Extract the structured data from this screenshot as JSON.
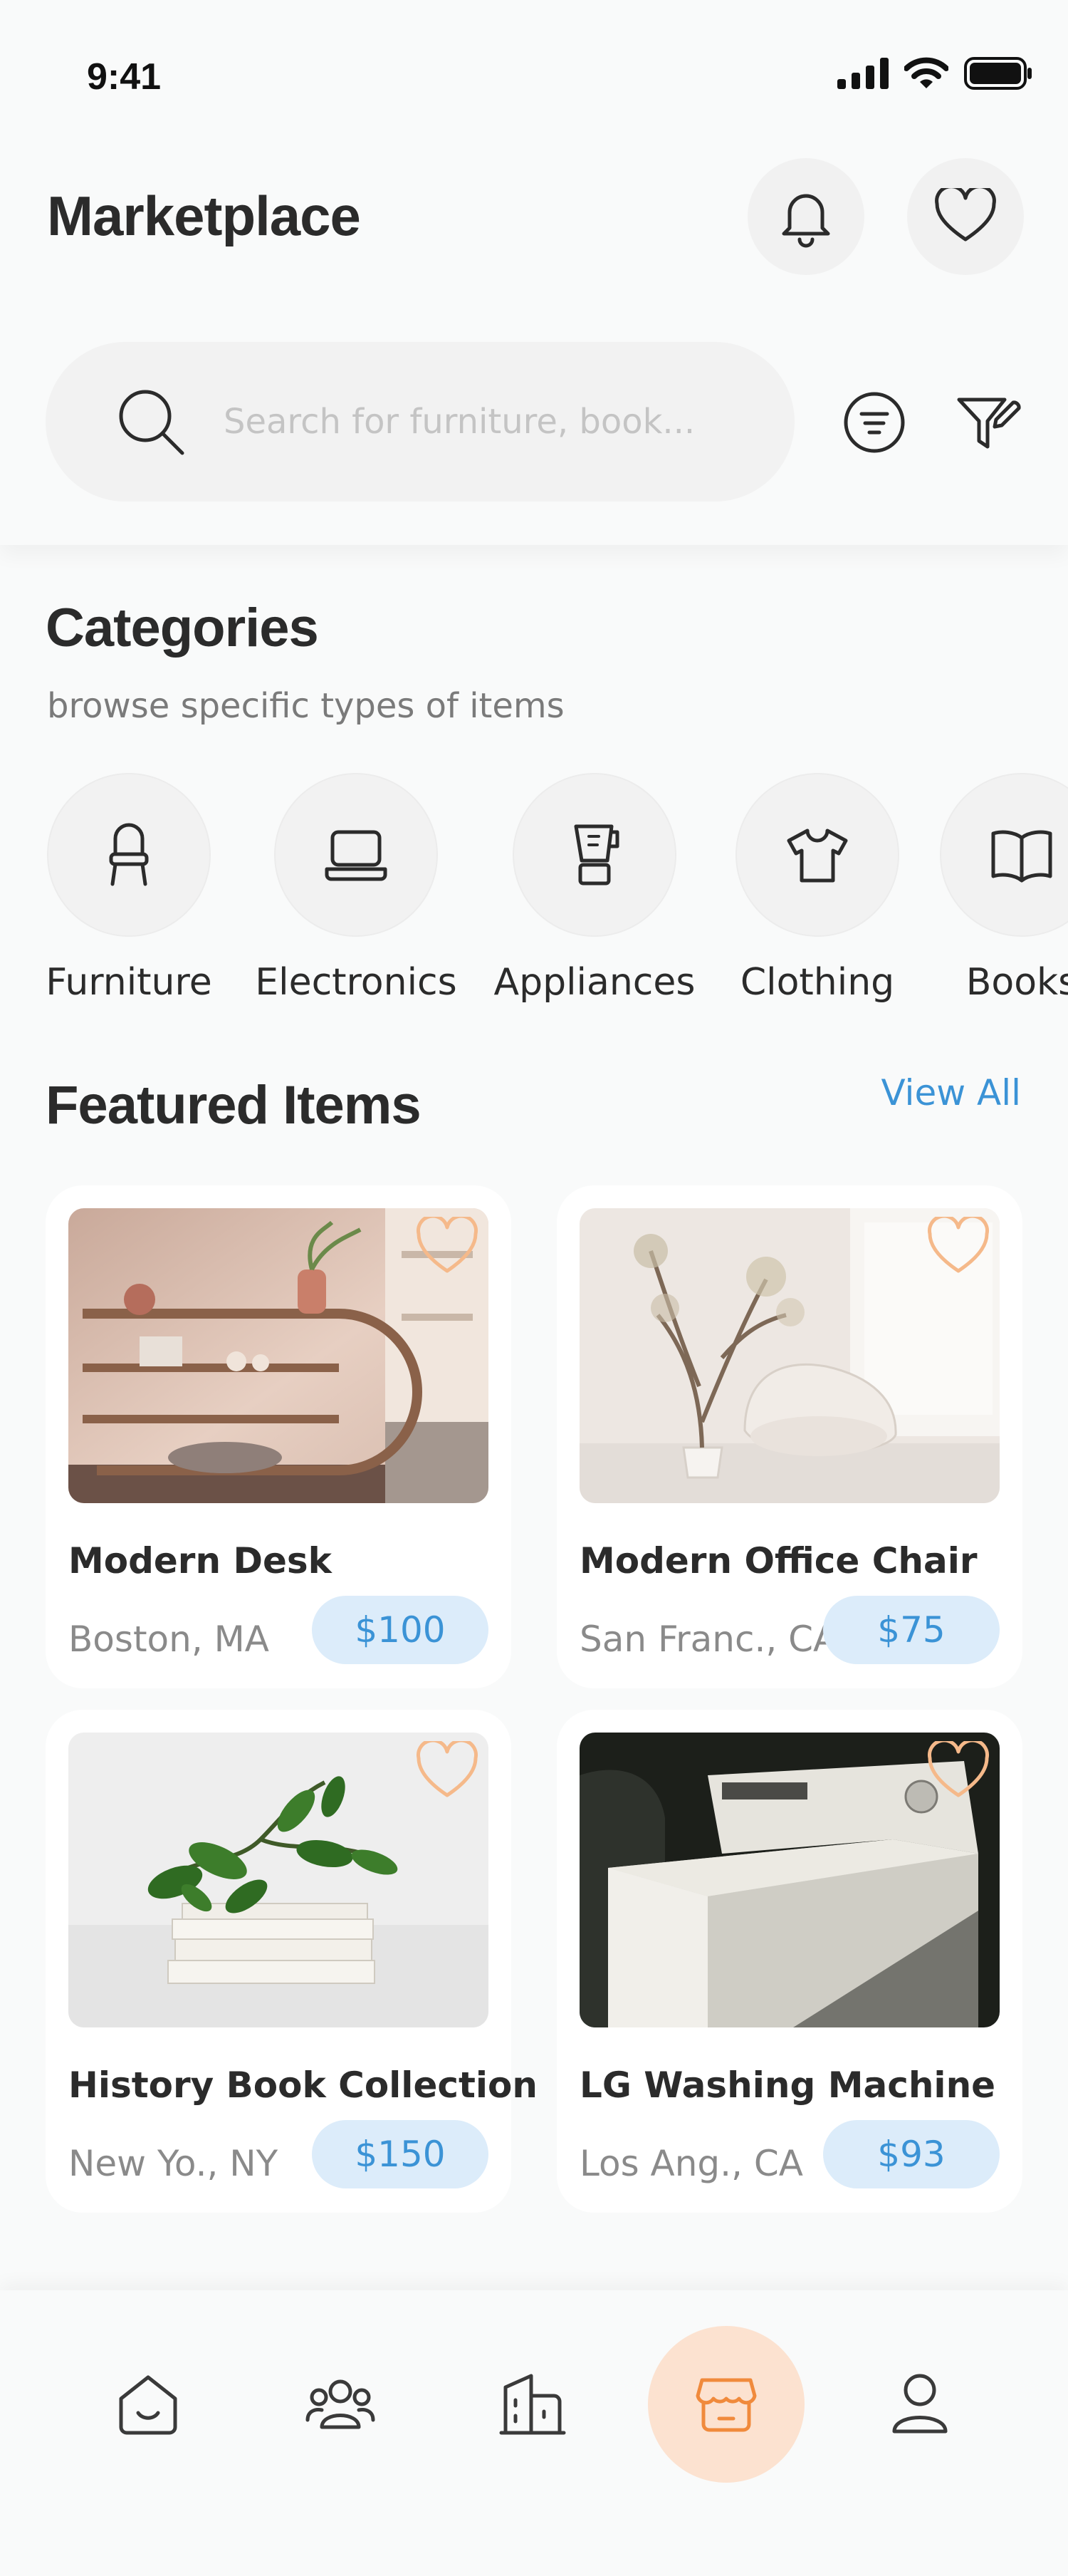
{
  "status": {
    "time": "9:41"
  },
  "header": {
    "title": "Marketplace",
    "search_placeholder": "Search for furniture, book..."
  },
  "categories": {
    "title": "Categories",
    "subtitle": "browse specific types of items",
    "items": [
      {
        "label": "Furniture",
        "icon": "chair-icon"
      },
      {
        "label": "Electronics",
        "icon": "laptop-icon"
      },
      {
        "label": "Appliances",
        "icon": "blender-icon"
      },
      {
        "label": "Clothing",
        "icon": "tshirt-icon"
      },
      {
        "label": "Books",
        "icon": "book-icon"
      }
    ]
  },
  "featured": {
    "title": "Featured Items",
    "view_all": "View All",
    "items": [
      {
        "name": "Modern Desk",
        "location": "Boston, MA",
        "price": "$100"
      },
      {
        "name": "Modern Office Chair",
        "location": "San Franc., CA",
        "price": "$75"
      },
      {
        "name": "History Book Collection",
        "location": "New Yo., NY",
        "price": "$150"
      },
      {
        "name": "LG Washing Machine",
        "location": "Los Ang., CA",
        "price": "$93"
      }
    ]
  },
  "bottom_nav": {
    "items": [
      {
        "icon": "home-icon"
      },
      {
        "icon": "community-icon"
      },
      {
        "icon": "buildings-icon"
      },
      {
        "icon": "store-icon",
        "active": true
      },
      {
        "icon": "profile-icon"
      }
    ]
  },
  "colors": {
    "accent_blue": "#3b93d6",
    "price_bg": "#dcecfa",
    "active_nav_bg": "#fce2d0",
    "active_nav_icon": "#f08a3c",
    "heart_outline": "#f5b98a"
  }
}
